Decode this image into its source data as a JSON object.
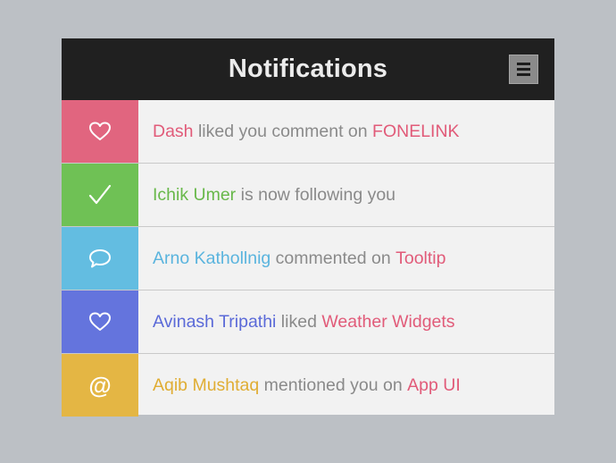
{
  "header": {
    "title": "Notifications",
    "menu_icon": "hamburger-menu-icon"
  },
  "colors": {
    "accent_pink": "#e15b79",
    "green": "#72c350",
    "blue": "#5fbbe0",
    "indigo": "#6676de",
    "yellow": "#e5b646"
  },
  "notifications": [
    {
      "icon": "heart-icon",
      "color": "#e1657f",
      "name": "Dash",
      "action": " liked you comment on ",
      "target": "FONELINK"
    },
    {
      "icon": "check-icon",
      "color": "#6fc155",
      "name": "Ichik Umer",
      "action": " is now following you",
      "target": ""
    },
    {
      "icon": "speech-bubble-icon",
      "color": "#63bde1",
      "name": "Arno Kathollnig",
      "action": " commented on ",
      "target": "Tooltip"
    },
    {
      "icon": "heart-icon",
      "color": "#6474dd",
      "name": "Avinash Tripathi",
      "action": " liked ",
      "target": "Weather Widgets"
    },
    {
      "icon": "at-sign-icon",
      "color": "#e4b644",
      "name": "Aqib Mushtaq",
      "action": " mentioned you on ",
      "target": "App UI",
      "icon_glyph": "@"
    }
  ]
}
